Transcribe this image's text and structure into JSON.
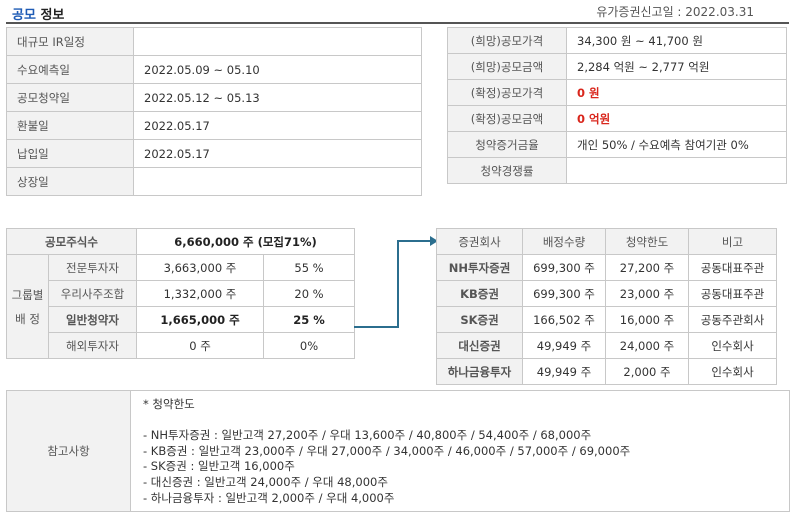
{
  "header": {
    "title_part1": "공모",
    "title_part2": "정보",
    "filing_date": "유가증권신고일 : 2022.03.31"
  },
  "schedule": [
    {
      "label": "대규모 IR일정",
      "value": ""
    },
    {
      "label": "수요예측일",
      "value": "2022.05.09 ~ 05.10"
    },
    {
      "label": "공모청약일",
      "value": "2022.05.12 ~ 05.13"
    },
    {
      "label": "환불일",
      "value": "2022.05.17"
    },
    {
      "label": "납입일",
      "value": "2022.05.17"
    },
    {
      "label": "상장일",
      "value": ""
    }
  ],
  "offering": [
    {
      "label": "(희망)공모가격",
      "value": "34,300 원 ~ 41,700 원"
    },
    {
      "label": "(희망)공모금액",
      "value": "2,284 억원  ~ 2,777 억원"
    },
    {
      "label": "(확정)공모가격",
      "value": "0 원"
    },
    {
      "label": "(확정)공모금액",
      "value": "0 억원"
    },
    {
      "label": "청약증거금율",
      "value": "개인 50% / 수요예측 참여기관 0%"
    },
    {
      "label": "청약경쟁률",
      "value": ""
    }
  ],
  "shares": {
    "total_label": "공모주식수",
    "total_value": "6,660,000  주  (모집71%)",
    "group_label_1": "그룹별",
    "group_label_2": "배  정",
    "rows": [
      {
        "name": "전문투자자",
        "shares": "3,663,000 주",
        "pct": "55 %"
      },
      {
        "name": "우리사주조합",
        "shares": "1,332,000 주",
        "pct": "20 %"
      },
      {
        "name": "일반청약자",
        "shares": "1,665,000  주",
        "pct": "25 %"
      },
      {
        "name": "해외투자자",
        "shares": "0 주",
        "pct": "0%"
      }
    ]
  },
  "underwriters": {
    "headers": [
      "증권회사",
      "배정수량",
      "청약한도",
      "비고"
    ],
    "rows": [
      {
        "name": "NH투자증권",
        "alloc": "699,300 주",
        "limit": "27,200 주",
        "note": "공동대표주관"
      },
      {
        "name": "KB증권",
        "alloc": "699,300 주",
        "limit": "23,000 주",
        "note": "공동대표주관"
      },
      {
        "name": "SK증권",
        "alloc": "166,502 주",
        "limit": "16,000 주",
        "note": "공동주관회사"
      },
      {
        "name": "대신증권",
        "alloc": "49,949 주",
        "limit": "24,000 주",
        "note": "인수회사"
      },
      {
        "name": "하나금융투자",
        "alloc": "49,949 주",
        "limit": "2,000 주",
        "note": "인수회사"
      }
    ]
  },
  "notes": {
    "label": "참고사항",
    "lines": [
      "* 청약한도",
      "",
      "- NH투자증권 : 일반고객 27,200주 / 우대 13,600주 / 40,800주 / 54,400주 / 68,000주",
      "- KB증권 : 일반고객 23,000주 / 우대 27,000주 / 34,000주 / 46,000주 / 57,000주 / 69,000주",
      "- SK증권 : 일반고객 16,000주",
      "- 대신증권 : 일반고객 24,000주 / 우대 48,000주",
      "- 하나금융투자 : 일반고객 2,000주 / 우대 4,000주"
    ]
  },
  "colors": {
    "accent_blue": "#1e5bb5",
    "emphasis_red": "#d9261c",
    "arrow_teal": "#2b6e8e",
    "label_bg": "#f2f2f2"
  }
}
